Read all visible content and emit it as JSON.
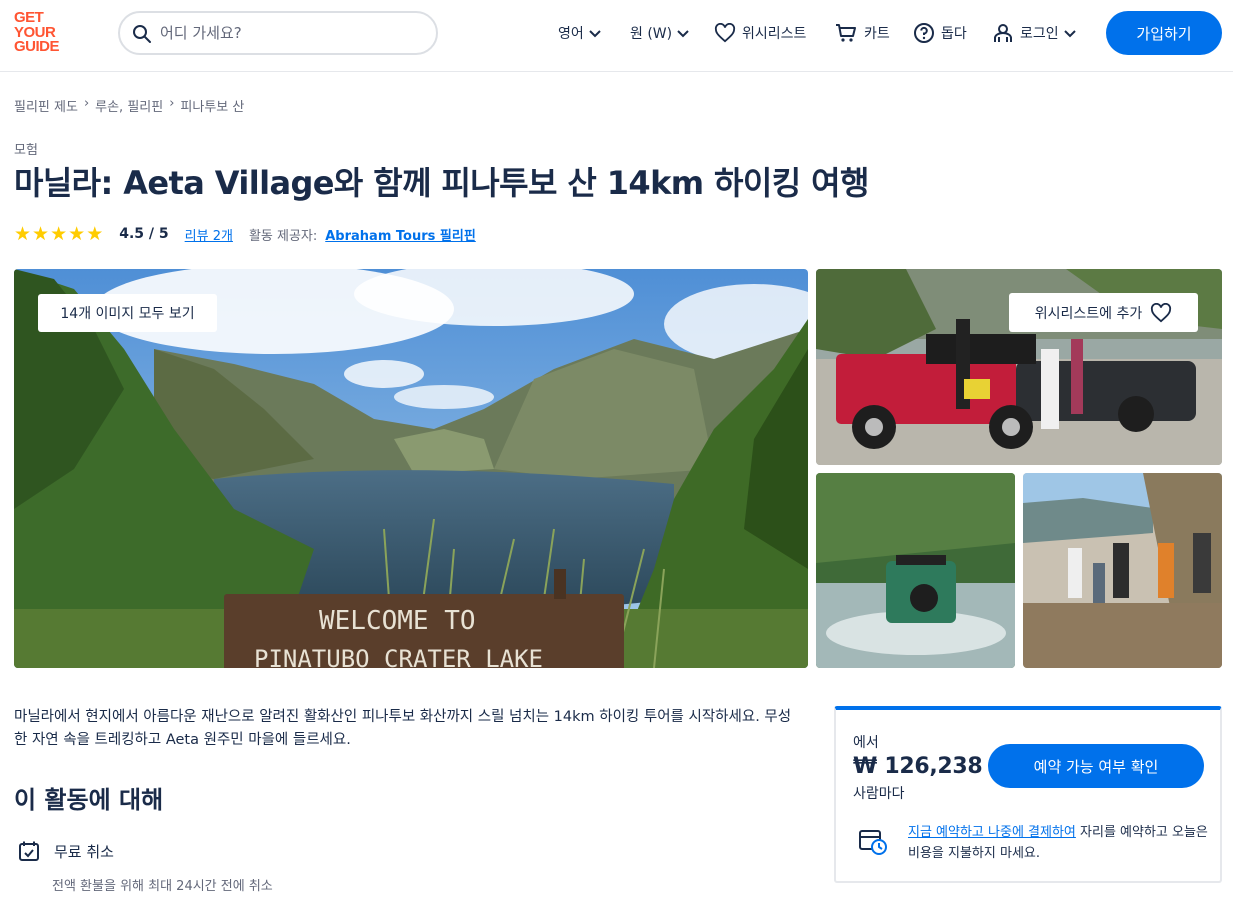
{
  "header": {
    "logo": [
      "GET",
      "YOUR",
      "GUIDE"
    ],
    "search_placeholder": "어디 가세요?",
    "language": "영어",
    "currency": "원 (W)",
    "wishlist": "위시리스트",
    "cart": "카트",
    "help": "돕다",
    "login": "로그인",
    "signup": "가입하기"
  },
  "breadcrumb": [
    "필리핀 제도",
    "루손, 필리핀",
    "피나투보 산"
  ],
  "category": "모험",
  "title": "마닐라: Aeta Village와 함께 피나투보 산 14km 하이킹 여행",
  "rating": {
    "stars": 5,
    "score": "4.5 / 5",
    "reviews": "리뷰 2개",
    "provider_label": "활동 제공자:",
    "provider": "Abraham Tours 필리핀"
  },
  "gallery": {
    "view_all": "14개 이미지 모두 보기",
    "add_wishlist": "위시리스트에 추가",
    "sign_line1": "WELCOME  TO",
    "sign_line2": "PINATUBO CRATER LAKE"
  },
  "description": "마닐라에서 현지에서 아름다운 재난으로 알려진 활화산인 피나투보 화산까지 스릴 넘치는 14km 하이킹 투어를 시작하세요. 무성한 자연 속을 트레킹하고 Aeta 원주민 마을에 들르세요.",
  "about": {
    "title": "이 활동에 대해",
    "feature_title": "무료 취소",
    "feature_sub": "전액 환불을 위해 최대 24시간 전에 취소"
  },
  "booking": {
    "from": "에서",
    "price": "₩ 126,238",
    "per_person": "사람마다",
    "check_button": "예약 가능 여부 확인",
    "reserve_link": "지금 예약하고 나중에 결제하여",
    "reserve_rest": " 자리를 예약하고 오늘은 비용을 지불하지 마세요."
  },
  "colors": {
    "brand": "#ff5533",
    "accent": "#0071eb",
    "star": "#ffcc00",
    "text": "#1a2b49"
  }
}
